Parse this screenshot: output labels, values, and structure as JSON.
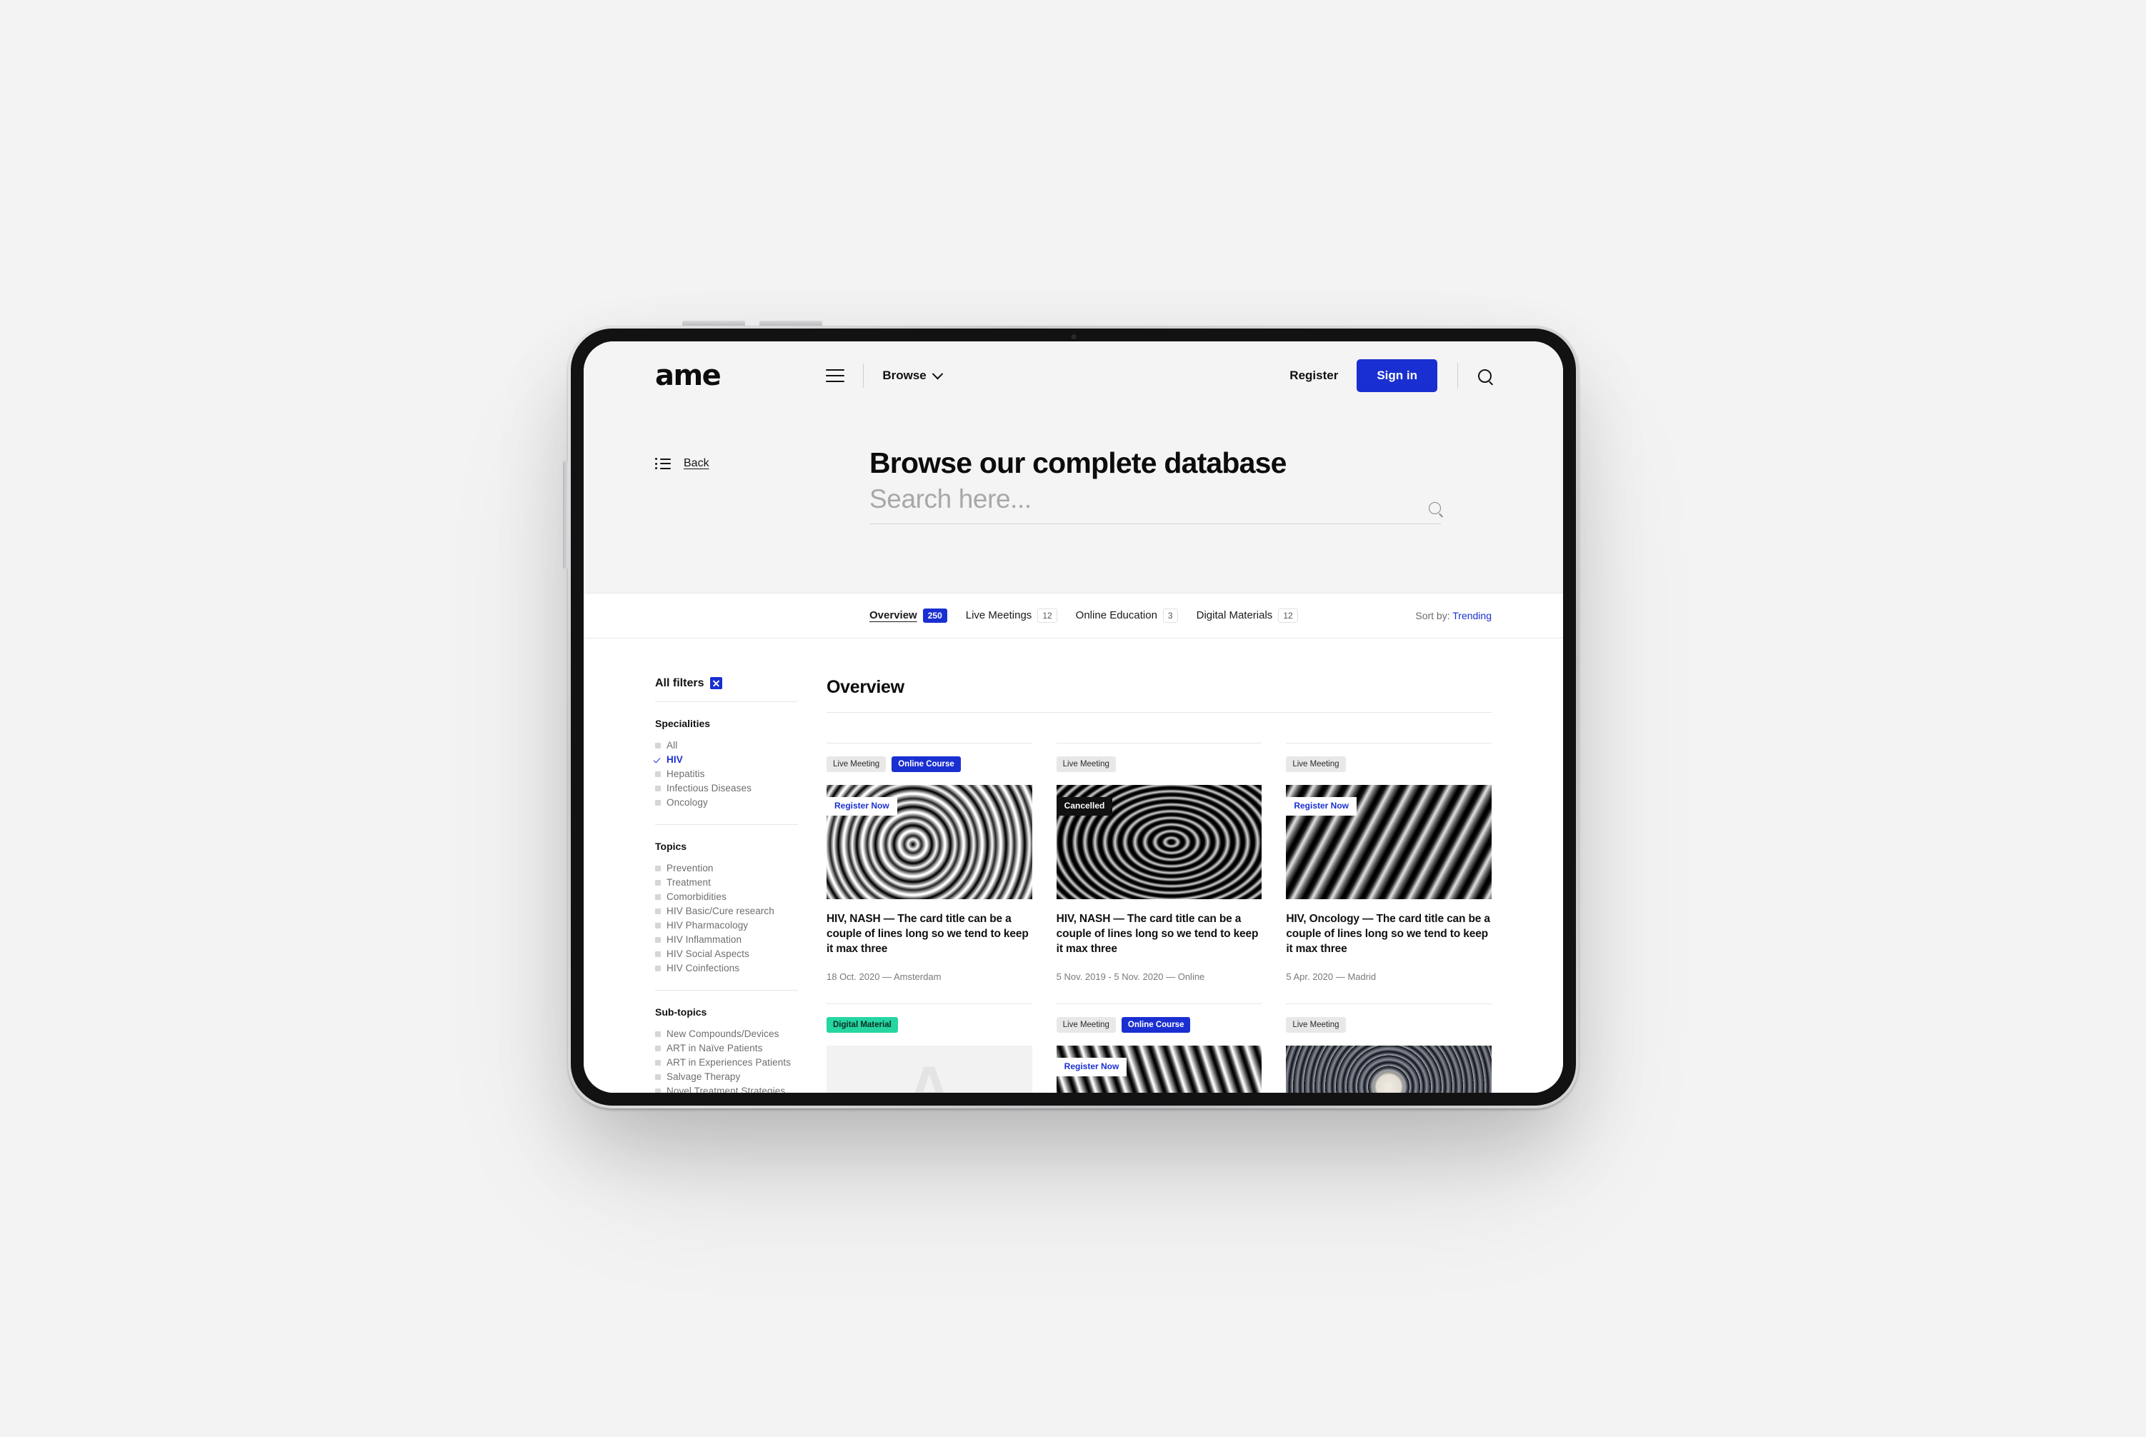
{
  "colors": {
    "brand_blue": "#1a2fd1",
    "accent_green": "#25d6a2",
    "page_bg": "#f3f3f3",
    "hero_bg": "#f4f4f4"
  },
  "nav": {
    "logo": "ame",
    "menu_icon": "hamburger-icon",
    "browse_label": "Browse",
    "register_label": "Register",
    "signin_label": "Sign in",
    "search_icon": "search-icon"
  },
  "hero": {
    "back_label": "Back",
    "back_icon": "list-icon",
    "title": "Browse our complete database",
    "search_placeholder": "Search here...",
    "search_value": "",
    "search_icon": "search-icon"
  },
  "tabs": [
    {
      "label": "Overview",
      "count": "250",
      "active": true
    },
    {
      "label": "Live Meetings",
      "count": "12",
      "active": false
    },
    {
      "label": "Online Education",
      "count": "3",
      "active": false
    },
    {
      "label": "Digital Materials",
      "count": "12",
      "active": false
    }
  ],
  "sort": {
    "label": "Sort by:",
    "value": "Trending"
  },
  "sidebar": {
    "all_filters_label": "All filters",
    "clear_icon": "close-icon",
    "groups": [
      {
        "title": "Specialities",
        "items": [
          {
            "label": "All",
            "selected": false
          },
          {
            "label": "HIV",
            "selected": true
          },
          {
            "label": "Hepatitis",
            "selected": false
          },
          {
            "label": "Infectious Diseases",
            "selected": false
          },
          {
            "label": "Oncology",
            "selected": false
          }
        ]
      },
      {
        "title": "Topics",
        "items": [
          {
            "label": "Prevention",
            "selected": false
          },
          {
            "label": "Treatment",
            "selected": false
          },
          {
            "label": "Comorbidities",
            "selected": false
          },
          {
            "label": "HIV Basic/Cure research",
            "selected": false
          },
          {
            "label": "HIV Pharmacology",
            "selected": false
          },
          {
            "label": "HIV Inflammation",
            "selected": false
          },
          {
            "label": "HIV Social Aspects",
            "selected": false
          },
          {
            "label": "HIV Coinfections",
            "selected": false
          }
        ]
      },
      {
        "title": "Sub-topics",
        "items": [
          {
            "label": "New Compounds/Devices",
            "selected": false
          },
          {
            "label": "ART in Naïve Patients",
            "selected": false
          },
          {
            "label": "ART in Experiences Patients",
            "selected": false
          },
          {
            "label": "Salvage Therapy",
            "selected": false
          },
          {
            "label": "Novel Treatment Strategies",
            "selected": false
          }
        ]
      }
    ]
  },
  "content": {
    "title": "Overview",
    "cards": [
      {
        "tags": [
          {
            "text": "Live Meeting",
            "style": "grey"
          },
          {
            "text": "Online Course",
            "style": "blue"
          }
        ],
        "media_badge": {
          "text": "Register Now",
          "style": "register"
        },
        "media": "swirl-grey-a",
        "title": "HIV, NASH — The card title can be a couple of lines long so we tend to keep it max three",
        "meta": "18 Oct. 2020 — Amsterdam"
      },
      {
        "tags": [
          {
            "text": "Live Meeting",
            "style": "grey"
          }
        ],
        "media_badge": {
          "text": "Cancelled",
          "style": "cancelled"
        },
        "media": "swirl-ring-b",
        "title": "HIV, NASH — The card title can be a couple of lines long so we tend to keep it max three",
        "meta": "5 Nov. 2019 - 5 Nov. 2020 — Online"
      },
      {
        "tags": [
          {
            "text": "Live Meeting",
            "style": "grey"
          }
        ],
        "media_badge": {
          "text": "Register Now",
          "style": "register"
        },
        "media": "swirl-dark-c",
        "title": "HIV, Oncology — The card title can be a couple of lines long so we tend to keep it max three",
        "meta": "5 Apr. 2020 — Madrid"
      },
      {
        "tags": [
          {
            "text": "Digital Material",
            "style": "green"
          }
        ],
        "media_badge": null,
        "media": "placeholder-a",
        "placeholder_letter": "A",
        "title": "",
        "meta": ""
      },
      {
        "tags": [
          {
            "text": "Live Meeting",
            "style": "grey"
          },
          {
            "text": "Online Course",
            "style": "blue"
          }
        ],
        "media_badge": {
          "text": "Register Now",
          "style": "register"
        },
        "media": "swirl-marble-d",
        "title": "",
        "meta": ""
      },
      {
        "tags": [
          {
            "text": "Live Meeting",
            "style": "grey"
          }
        ],
        "media_badge": null,
        "media": "virus-dark-e",
        "title": "",
        "meta": ""
      }
    ]
  }
}
